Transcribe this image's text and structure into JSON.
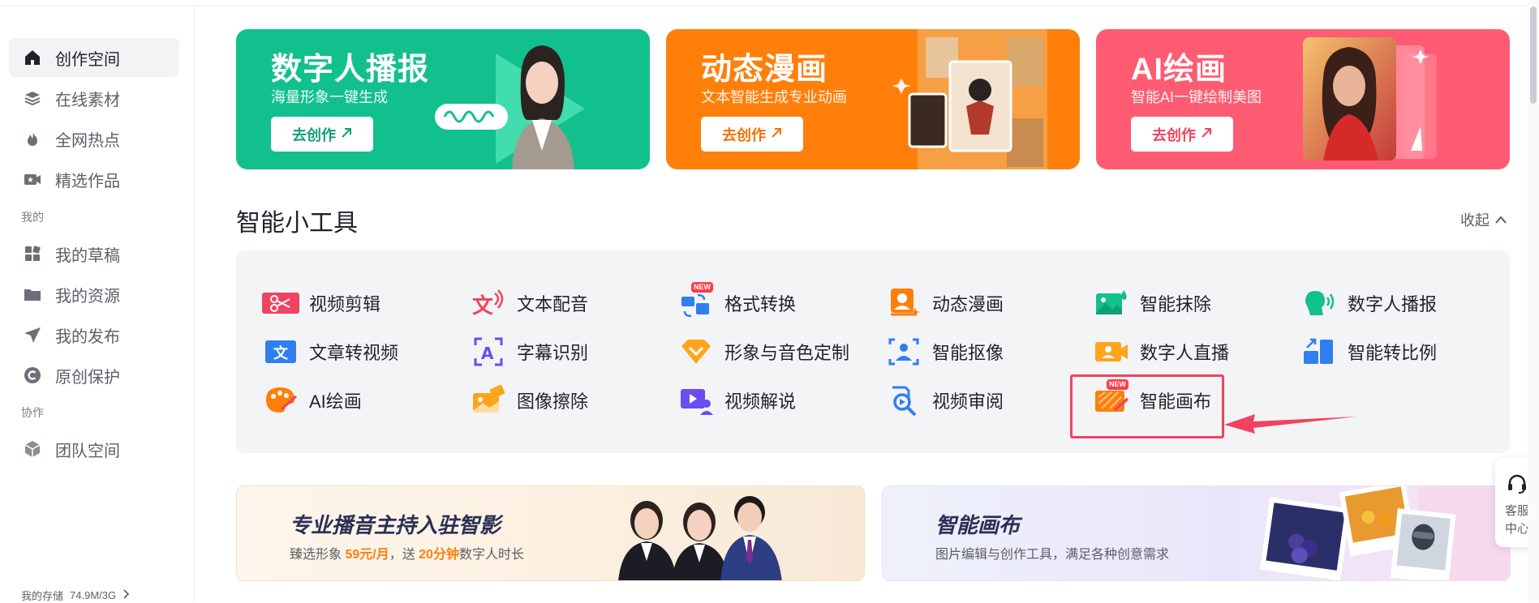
{
  "sidebar": {
    "items": [
      {
        "label": "创作空间",
        "icon": "home-icon",
        "active": true
      },
      {
        "label": "在线素材",
        "icon": "layers-icon"
      },
      {
        "label": "全网热点",
        "icon": "fire-icon"
      },
      {
        "label": "精选作品",
        "icon": "video-star-icon"
      }
    ],
    "mine_label": "我的",
    "mine_items": [
      {
        "label": "我的草稿",
        "icon": "grid-icon"
      },
      {
        "label": "我的资源",
        "icon": "folder-icon"
      },
      {
        "label": "我的发布",
        "icon": "send-icon"
      },
      {
        "label": "原创保护",
        "icon": "copyright-icon"
      }
    ],
    "collab_label": "协作",
    "collab_items": [
      {
        "label": "团队空间",
        "icon": "cube-icon"
      }
    ],
    "storage_label": "我的存储",
    "storage_value": "74.9M/3G"
  },
  "banners": [
    {
      "title": "数字人播报",
      "subtitle": "海量形象一键生成",
      "button": "去创作",
      "color": "#12c08e",
      "btn_color": "#0e9f73"
    },
    {
      "title": "动态漫画",
      "subtitle": "文本智能生成专业动画",
      "button": "去创作",
      "color": "#ff7f0a",
      "btn_color": "#f27300"
    },
    {
      "title": "AI绘画",
      "subtitle": "智能AI一键绘制美图",
      "button": "去创作",
      "color": "#ff5b72",
      "btn_color": "#f0435f"
    }
  ],
  "tools_section": {
    "title": "智能小工具",
    "collapse_label": "收起",
    "tools": [
      {
        "label": "视频剪辑",
        "icon": "video-cut-icon",
        "color": "#f0435f"
      },
      {
        "label": "文本配音",
        "icon": "text-voice-icon",
        "color": "#f0435f"
      },
      {
        "label": "格式转换",
        "icon": "format-convert-icon",
        "color": "#2f7ff0",
        "new": "NEW"
      },
      {
        "label": "动态漫画",
        "icon": "comic-icon",
        "color": "#ff7f0a"
      },
      {
        "label": "智能抹除",
        "icon": "smart-erase-icon",
        "color": "#12c08e"
      },
      {
        "label": "数字人播报",
        "icon": "digital-human-icon",
        "color": "#12c08e"
      },
      {
        "label": "文章转视频",
        "icon": "article-video-icon",
        "color": "#2f7ff0"
      },
      {
        "label": "字幕识别",
        "icon": "subtitle-icon",
        "color": "#6a4cf0"
      },
      {
        "label": "形象与音色定制",
        "icon": "diamond-icon",
        "color": "#ffa41b"
      },
      {
        "label": "智能抠像",
        "icon": "matting-icon",
        "color": "#2f7ff0"
      },
      {
        "label": "数字人直播",
        "icon": "live-icon",
        "color": "#ffa41b"
      },
      {
        "label": "智能转比例",
        "icon": "ratio-icon",
        "color": "#2f7ff0"
      },
      {
        "label": "AI绘画",
        "icon": "palette-icon",
        "color": "#ff7f0a"
      },
      {
        "label": "图像擦除",
        "icon": "image-erase-icon",
        "color": "#ffa41b"
      },
      {
        "label": "视频解说",
        "icon": "video-narrate-icon",
        "color": "#6a4cf0"
      },
      {
        "label": "视频审阅",
        "icon": "video-review-icon",
        "color": "#2f7ff0"
      },
      {
        "label": "智能画布",
        "icon": "smart-canvas-icon",
        "color": "#ff7f0a",
        "new": "NEW"
      }
    ]
  },
  "promos": [
    {
      "title": "专业播音主持入驻智影",
      "subtitle_pre": "臻选形象 ",
      "price": "59元/月",
      "subtitle_mid": "，送 ",
      "minutes": "20分钟",
      "subtitle_post": "数字人时长"
    },
    {
      "title": "智能画布",
      "subtitle": "图片编辑与创作工具，满足各种创意需求"
    }
  ],
  "service": {
    "label": "客服中心"
  }
}
